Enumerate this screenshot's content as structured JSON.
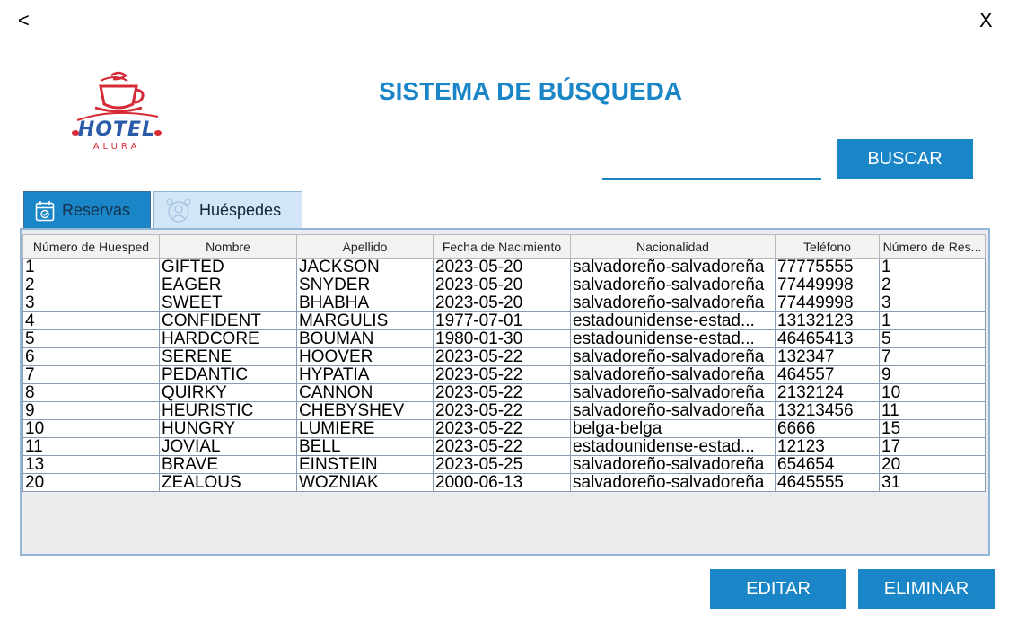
{
  "window": {
    "back_label": "<",
    "close_label": "X"
  },
  "logo": {
    "line1": "HOTEL",
    "line2": "ALURA"
  },
  "title": "SISTEMA DE BÚSQUEDA",
  "search": {
    "value": "",
    "button_label": "BUSCAR"
  },
  "tabs": [
    {
      "label": "Reservas",
      "icon": "calendar-icon",
      "selected": false
    },
    {
      "label": "Huéspedes",
      "icon": "guests-icon",
      "selected": true
    }
  ],
  "table": {
    "columns": [
      "Número de Huesped",
      "Nombre",
      "Apellido",
      "Fecha de Nacimiento",
      "Nacionalidad",
      "Teléfono",
      "Número de Res..."
    ],
    "rows": [
      [
        "1",
        "GIFTED",
        "JACKSON",
        "2023-05-20",
        "salvadoreño-salvadoreña",
        "77775555",
        "1"
      ],
      [
        "2",
        "EAGER",
        "SNYDER",
        "2023-05-20",
        "salvadoreño-salvadoreña",
        "77449998",
        "2"
      ],
      [
        "3",
        "SWEET",
        "BHABHA",
        "2023-05-20",
        "salvadoreño-salvadoreña",
        "77449998",
        "3"
      ],
      [
        "4",
        "CONFIDENT",
        "MARGULIS",
        "1977-07-01",
        "estadounidense-estad...",
        "13132123",
        "1"
      ],
      [
        "5",
        "HARDCORE",
        "BOUMAN",
        "1980-01-30",
        "estadounidense-estad...",
        "46465413",
        "5"
      ],
      [
        "6",
        "SERENE",
        "HOOVER",
        "2023-05-22",
        "salvadoreño-salvadoreña",
        "132347",
        "7"
      ],
      [
        "7",
        "PEDANTIC",
        "HYPATIA",
        "2023-05-22",
        "salvadoreño-salvadoreña",
        "464557",
        "9"
      ],
      [
        "8",
        "QUIRKY",
        "CANNON",
        "2023-05-22",
        "salvadoreño-salvadoreña",
        "2132124",
        "10"
      ],
      [
        "9",
        "HEURISTIC",
        "CHEBYSHEV",
        "2023-05-22",
        "salvadoreño-salvadoreña",
        "13213456",
        "11"
      ],
      [
        "10",
        "HUNGRY",
        "LUMIERE",
        "2023-05-22",
        "belga-belga",
        "6666",
        "15"
      ],
      [
        "11",
        "JOVIAL",
        "BELL",
        "2023-05-22",
        "estadounidense-estad...",
        "12123",
        "17"
      ],
      [
        "13",
        "BRAVE",
        "EINSTEIN",
        "2023-05-25",
        "salvadoreño-salvadoreña",
        "654654",
        "20"
      ],
      [
        "20",
        "ZEALOUS",
        "WOZNIAK",
        "2000-06-13",
        "salvadoreño-salvadoreña",
        "4645555",
        "31"
      ]
    ]
  },
  "actions": {
    "edit_label": "EDITAR",
    "delete_label": "ELIMINAR"
  },
  "colors": {
    "accent": "#1a86c8",
    "logo_red": "#d62b36",
    "logo_blue": "#2a5aa8"
  }
}
